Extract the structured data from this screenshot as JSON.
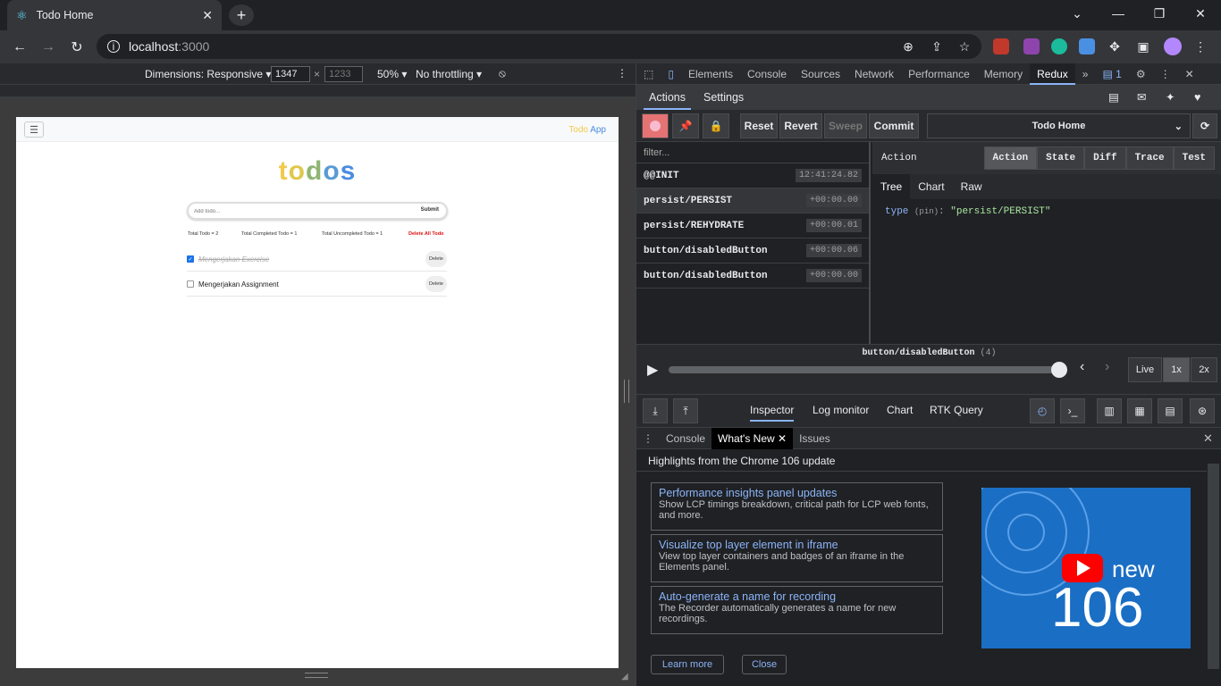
{
  "browser": {
    "tab_title": "Todo Home",
    "url_host": "localhost",
    "url_port": ":3000"
  },
  "device_toolbar": {
    "dimensions_label": "Dimensions: Responsive",
    "width": "1347",
    "height": "1233",
    "times": "×",
    "zoom": "50%",
    "throttling": "No throttling"
  },
  "app": {
    "brand_todo": "Todo",
    "brand_app": "App",
    "logo_letters": [
      "t",
      "o",
      "d",
      "o",
      "s"
    ],
    "logo_colors": [
      "#f2c94c",
      "#e0c84a",
      "#8fb573",
      "#5a9bd5",
      "#4a8de0"
    ],
    "input_placeholder": "Add todo...",
    "submit_label": "Submit",
    "stats": {
      "total": "Total Todo = 2",
      "completed": "Total Completed Todo = 1",
      "uncompleted": "Total Uncompleted Todo = 1",
      "delete_all": "Delete All Todo"
    },
    "todos": [
      {
        "text": "Mengerjakan Exercise",
        "done": true,
        "delete_label": "Delete"
      },
      {
        "text": "Mengerjakan Assignment",
        "done": false,
        "delete_label": "Delete"
      }
    ]
  },
  "devtools": {
    "tabs": [
      "Elements",
      "Console",
      "Sources",
      "Network",
      "Performance",
      "Memory",
      "Redux"
    ],
    "issues_count": "1"
  },
  "redux": {
    "top_tabs": [
      "Actions",
      "Settings"
    ],
    "buttons": {
      "reset": "Reset",
      "revert": "Revert",
      "sweep": "Sweep",
      "commit": "Commit"
    },
    "instance": "Todo Home",
    "filter_placeholder": "filter...",
    "actions": [
      {
        "name": "@@INIT",
        "time": "12:41:24.82"
      },
      {
        "name": "persist/PERSIST",
        "time": "+00:00.00"
      },
      {
        "name": "persist/REHYDRATE",
        "time": "+00:00.01"
      },
      {
        "name": "button/disabledButton",
        "time": "+00:00.06"
      },
      {
        "name": "button/disabledButton",
        "time": "+00:00.00"
      }
    ],
    "panel_title": "Action",
    "panel_tabs": [
      "Action",
      "State",
      "Diff",
      "Trace",
      "Test"
    ],
    "sub_tabs": [
      "Tree",
      "Chart",
      "Raw"
    ],
    "tree": {
      "key": "type",
      "tag": "(pin)",
      "value": "\"persist/PERSIST\""
    },
    "slider_label": "button/disabledButton",
    "slider_count": "(4)",
    "speeds": [
      "Live",
      "1x",
      "2x"
    ],
    "monitors": [
      "Inspector",
      "Log monitor",
      "Chart",
      "RTK Query"
    ]
  },
  "drawer": {
    "tabs": [
      "Console",
      "What's New",
      "Issues"
    ],
    "heading": "Highlights from the Chrome 106 update",
    "cards": [
      {
        "title": "Performance insights panel updates",
        "desc": "Show LCP timings breakdown, critical path for LCP web fonts, and more."
      },
      {
        "title": "Visualize top layer element in iframe",
        "desc": "View top layer containers and badges of an iframe in the Elements panel."
      },
      {
        "title": "Auto-generate a name for recording",
        "desc": "The Recorder automatically generates a name for new recordings."
      }
    ],
    "video_new": "new",
    "video_num": "106",
    "learn_more": "Learn more",
    "close": "Close"
  }
}
